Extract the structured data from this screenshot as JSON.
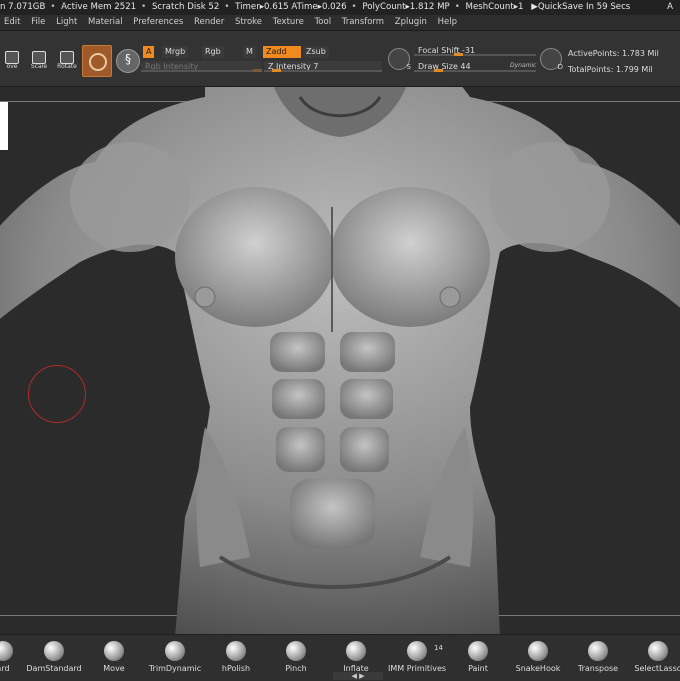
{
  "status": {
    "items": [
      "n 7.071GB",
      "Active Mem 2521",
      "Scratch Disk 52",
      "Timer▸0.615 ATime▸0.026",
      "PolyCount▸1.812 MP",
      "MeshCount▸1",
      "▶QuickSave In 59 Secs"
    ],
    "right_letter": "A"
  },
  "menu": [
    "Edit",
    "File",
    "Light",
    "Material",
    "Preferences",
    "Render",
    "Stroke",
    "Texture",
    "Tool",
    "Transform",
    "Zplugin",
    "Help"
  ],
  "toolbar": {
    "move_label": "ove",
    "scale_label": "Scale",
    "rotate_label": "Rotate",
    "a_label": "A",
    "mrgb_label": "Mrgb",
    "rgb_label": "Rgb",
    "m_label": "M",
    "zadd_label": "Zadd",
    "zsub_label": "Zsub",
    "rgb_intensity_label": "Rgb Intensity",
    "z_intensity_label": "Z Intensity",
    "z_intensity_value": "7",
    "focal_shift_label": "Focal Shift",
    "focal_shift_value": "-31",
    "draw_size_label": "Draw Size",
    "draw_size_value": "44",
    "dynamic_label": "Dynamic",
    "s_badge": "S",
    "d_badge": "D",
    "active_points_label": "ActivePoints:",
    "active_points_value": "1.783 Mil",
    "total_points_label": "TotalPoints:",
    "total_points_value": "1.799 Mil"
  },
  "levels": {
    "z_intensity": 0.07,
    "focal_shift": 0.35,
    "draw_size": 0.18
  },
  "colors": {
    "accent": "#f08a1f",
    "brush_cursor": "#b02a2a"
  },
  "brushes": [
    {
      "label": "ard"
    },
    {
      "label": "DamStandard"
    },
    {
      "label": "Move"
    },
    {
      "label": "TrimDynamic"
    },
    {
      "label": "hPolish"
    },
    {
      "label": "Pinch"
    },
    {
      "label": "Inflate"
    },
    {
      "label": "IMM Primitives"
    },
    {
      "label": "Paint"
    },
    {
      "label": "SnakeHook"
    },
    {
      "label": "Transpose"
    },
    {
      "label": "SelectLasso"
    }
  ],
  "imm_count": "14"
}
